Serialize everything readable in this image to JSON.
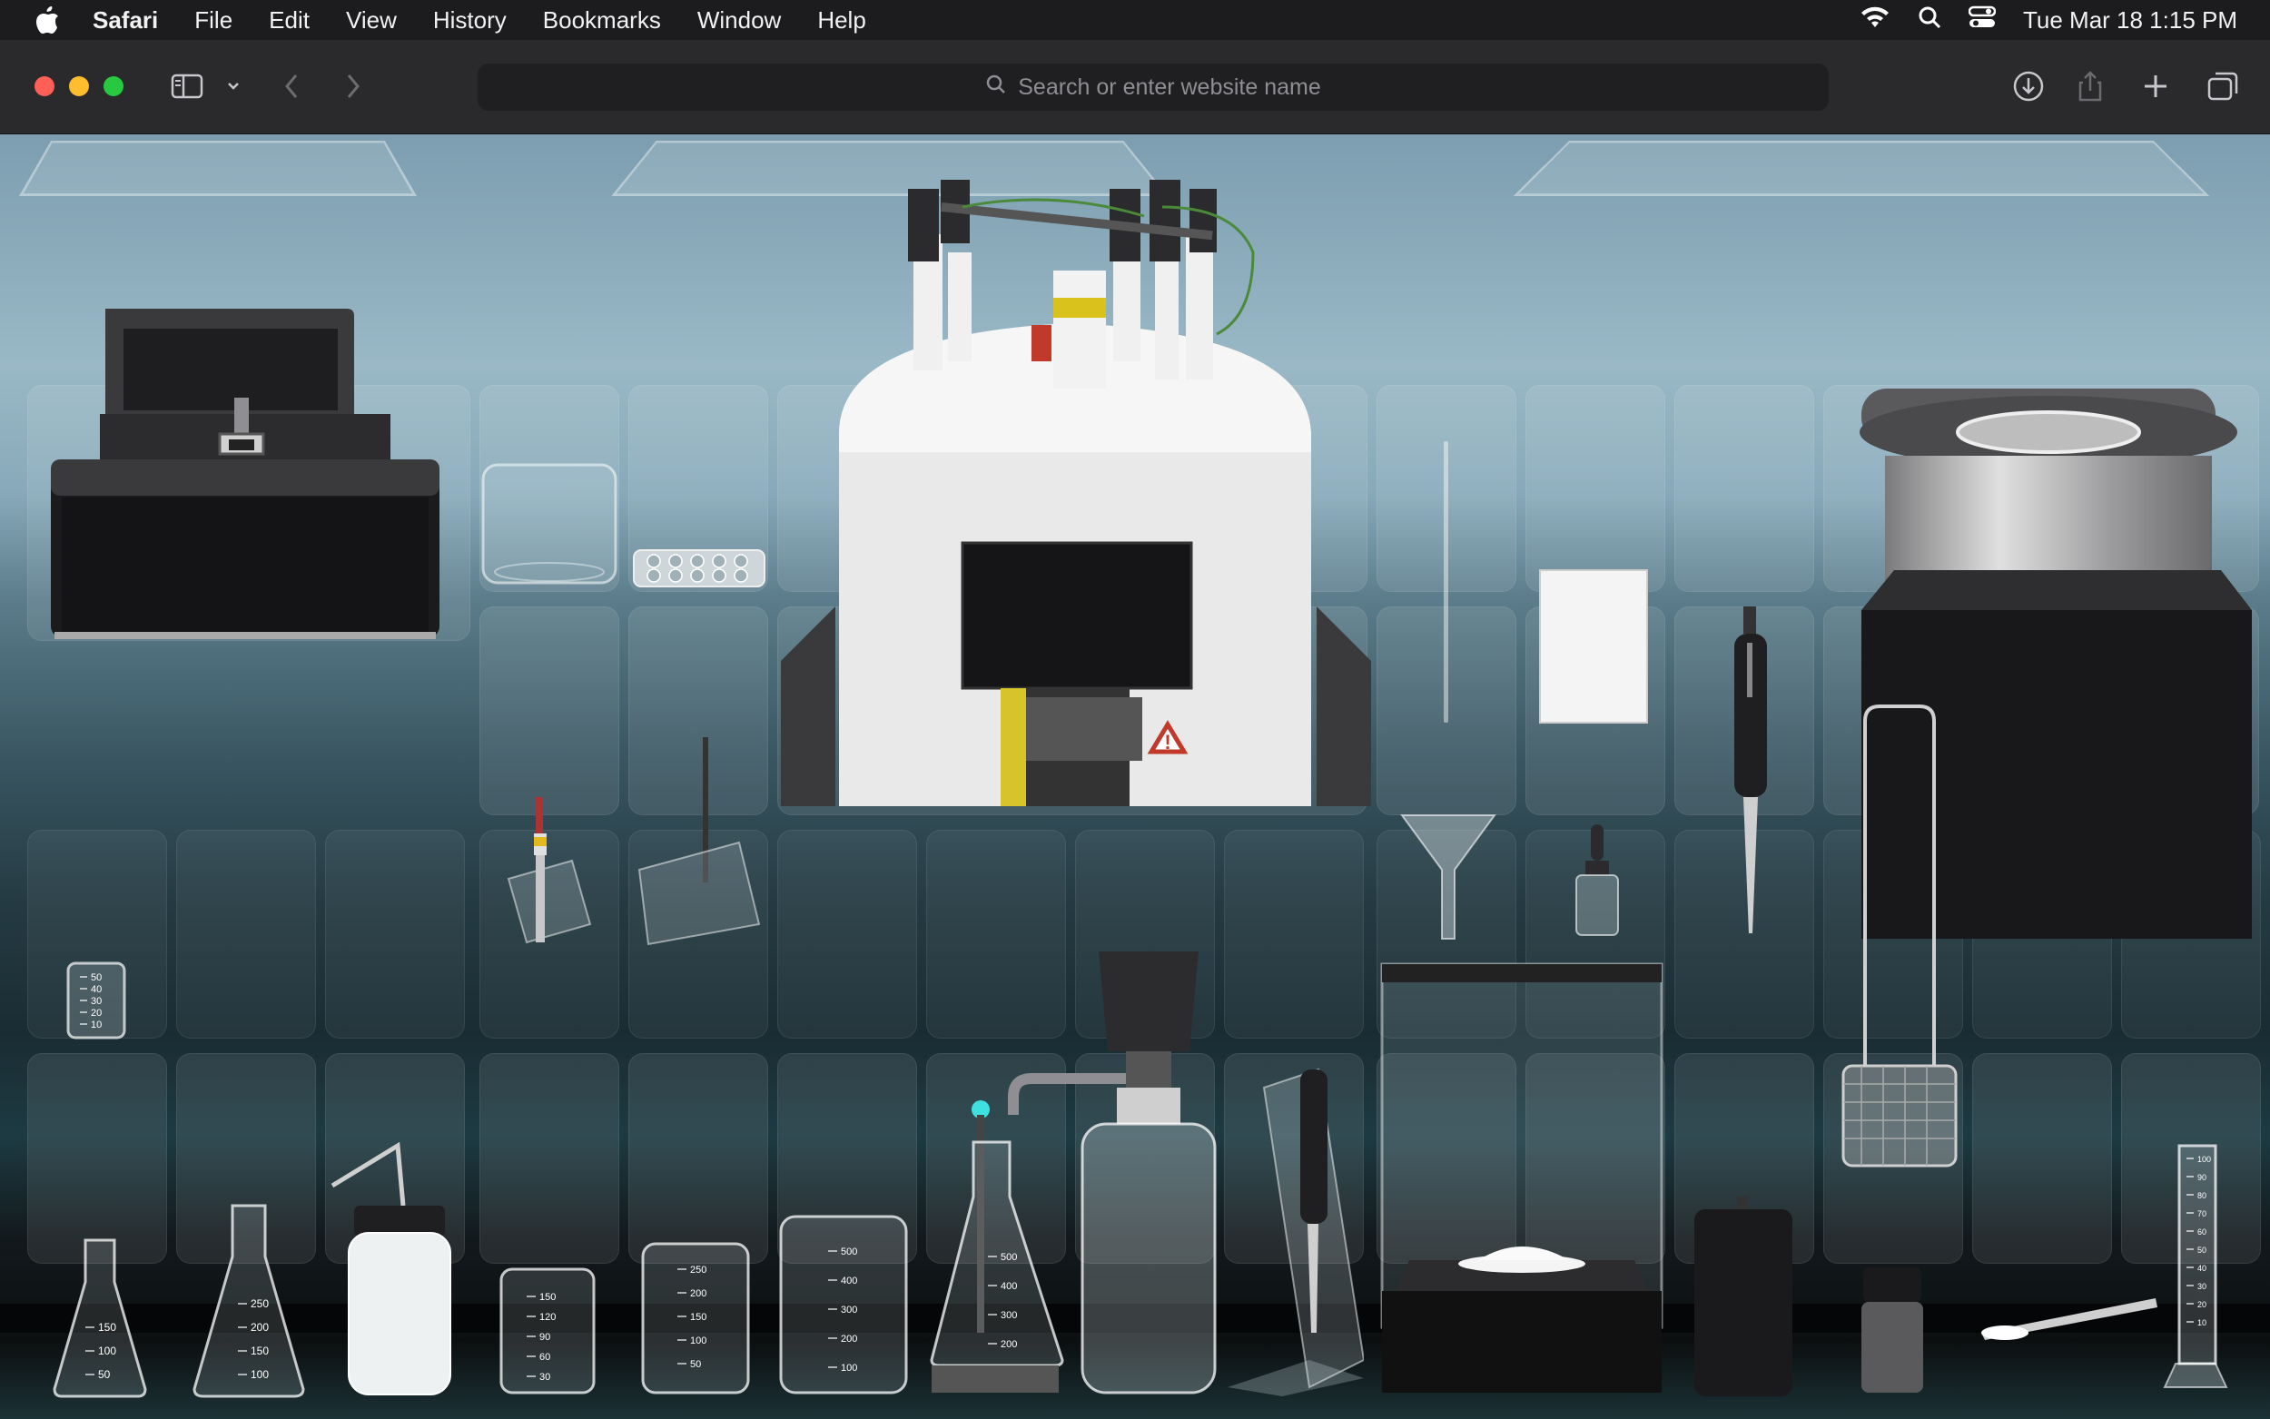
{
  "menubar": {
    "app_name": "Safari",
    "items": [
      "File",
      "Edit",
      "View",
      "History",
      "Bookmarks",
      "Window",
      "Help"
    ],
    "clock": "Tue Mar 18  1:15 PM"
  },
  "toolbar": {
    "url_placeholder": "Search or enter website name"
  },
  "lab": {
    "small_beaker_marks": [
      "50",
      "40",
      "30",
      "20",
      "10"
    ],
    "flask_small_marks": [
      "150",
      "100",
      "50"
    ],
    "flask_large_marks": [
      "250",
      "200",
      "150",
      "100"
    ],
    "beaker_150_marks": [
      "150",
      "120",
      "90",
      "60",
      "30"
    ],
    "beaker_250_marks": [
      "250",
      "200",
      "150",
      "100",
      "50"
    ],
    "beaker_500_marks": [
      "500",
      "400",
      "300",
      "200",
      "100"
    ],
    "flask_500_marks": [
      "500",
      "400",
      "300",
      "200"
    ],
    "cylinder_marks": [
      "100",
      "90",
      "80",
      "70",
      "60",
      "50",
      "40",
      "30",
      "20",
      "10"
    ],
    "warning_symbol": "!"
  },
  "colors": {
    "menubar_bg": "#1c1c1e",
    "toolbar_bg": "#2a2a2c",
    "traffic_red": "#ff5f57",
    "traffic_yellow": "#febc2e",
    "traffic_green": "#28c840"
  }
}
